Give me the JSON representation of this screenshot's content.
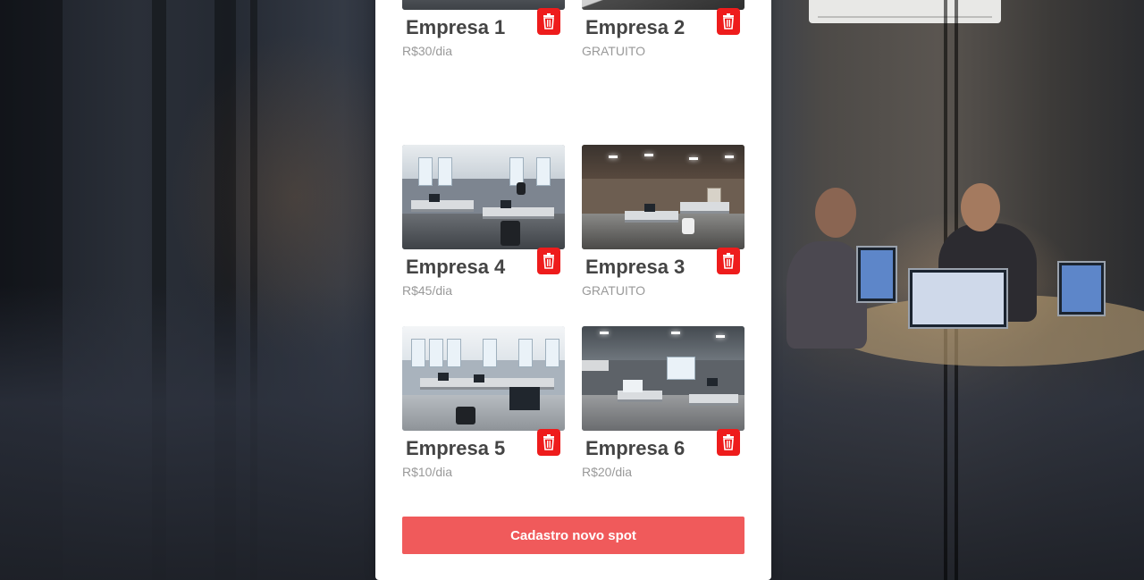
{
  "spots": [
    {
      "name": "Empresa 1",
      "price": "R$30/dia",
      "thumb_style": "shot1"
    },
    {
      "name": "Empresa 2",
      "price": "GRATUITO",
      "thumb_style": "shot2"
    },
    {
      "name": "Empresa 4",
      "price": "R$45/dia",
      "thumb_style": "light"
    },
    {
      "name": "Empresa 3",
      "price": "GRATUITO",
      "thumb_style": "warm"
    },
    {
      "name": "Empresa 5",
      "price": "R$10/dia",
      "thumb_style": "light"
    },
    {
      "name": "Empresa 6",
      "price": "R$20/dia",
      "thumb_style": "dark"
    }
  ],
  "actions": {
    "new_spot_label": "Cadastro novo spot",
    "delete_icon": "trash-icon"
  },
  "colors": {
    "delete_red": "#ee1c1c",
    "primary_button": "#f05a5b",
    "name_text": "#444444",
    "price_text": "#999999"
  }
}
